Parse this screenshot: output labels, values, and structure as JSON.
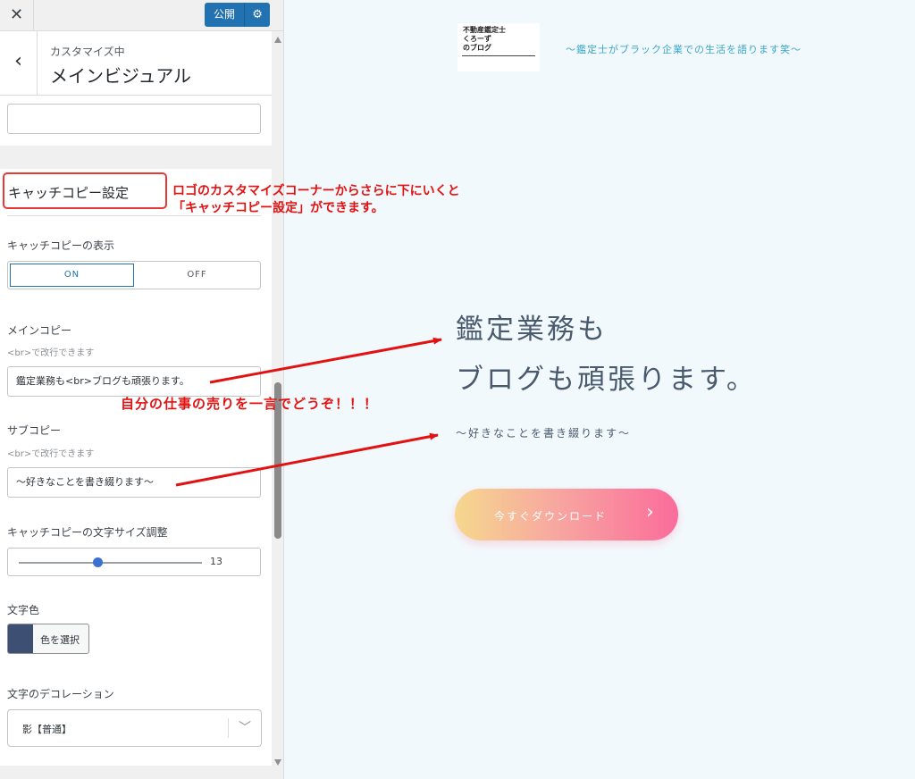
{
  "topbar": {
    "close_icon": "close-icon",
    "close_glyph": "✕",
    "publish_label": "公開",
    "settings_icon": "gear-icon",
    "settings_glyph": "⚙"
  },
  "section": {
    "back_icon": "chevron-left-icon",
    "back_glyph": "‹",
    "breadcrumb": "カスタマイズ中",
    "title": "メインビジュアル"
  },
  "catch": {
    "heading": "キャッチコピー設定",
    "display_label": "キャッチコピーの表示",
    "toggle_on": "ON",
    "toggle_off": "OFF",
    "toggle_selected": "ON",
    "main_copy_label": "メインコピー",
    "main_copy_hint": "<br>で改行できます",
    "main_copy_value": "鑑定業務も<br>ブログも頑張ります。",
    "sub_copy_label": "サブコピー",
    "sub_copy_hint": "<br>で改行できます",
    "sub_copy_value": "～好きなことを書き綴ります～",
    "font_size_label": "キャッチコピーの文字サイズ調整",
    "font_size_value": "13",
    "font_size_slider_fraction": 0.43,
    "text_color_label": "文字色",
    "text_color_button": "色を選択",
    "text_color_value": "#3e4f74",
    "decoration_label": "文字のデコレーション",
    "decoration_value": "影【普通】",
    "dropdown_icon": "chevron-down-icon",
    "dropdown_glyph": "﹀"
  },
  "preview": {
    "logo_text": "不動産鑑定士\nくろーず\nのブログ",
    "tagline": "～鑑定士がブラック企業での生活を語ります笑～",
    "main_copy_line1": "鑑定業務も",
    "main_copy_line2": "ブログも頑張ります。",
    "sub_copy": "～好きなことを書き綴ります～",
    "cta_label": "今すぐダウンロード",
    "cta_arrow_glyph": "›"
  },
  "annotations": {
    "note_1_line1": "ロゴのカスタマイズコーナーからさらに下にいくと",
    "note_1_line2": "「キャッチコピー設定」ができます。",
    "note_2": "自分の仕事の売りを一言でどうぞ！！！",
    "color": "#e31212"
  },
  "colors": {
    "publish": "#2271b1",
    "toggle_active": "#2271b1",
    "slider_knob": "#3b6fd4",
    "tagline": "#3aa6c9",
    "copy_text": "#4a5a6e"
  }
}
